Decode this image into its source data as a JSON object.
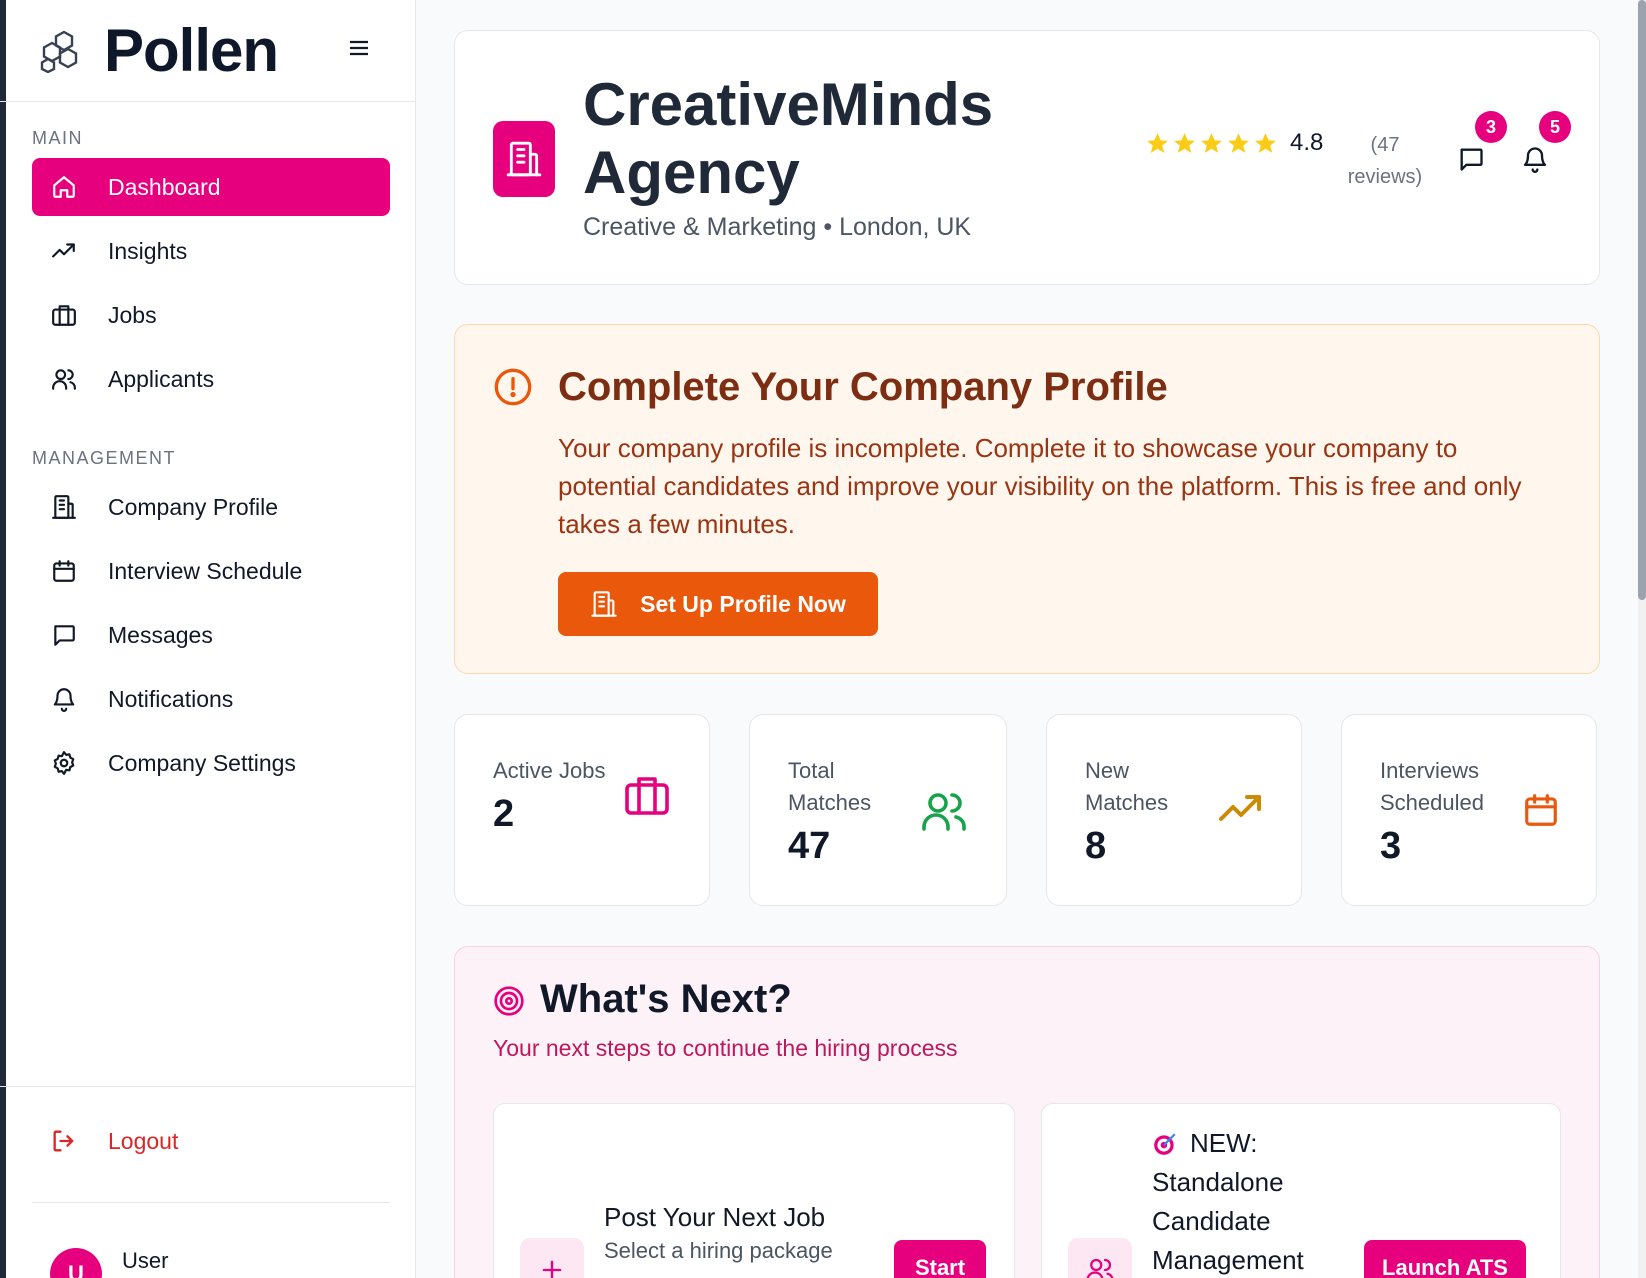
{
  "brand": {
    "name": "Pollen"
  },
  "colors": {
    "brand_pink": "#e6007e",
    "alert_orange": "#ea580c",
    "star_yellow": "#facc15"
  },
  "sidebar": {
    "main_label": "MAIN",
    "main_items": [
      {
        "label": "Dashboard",
        "icon": "home-icon",
        "active": true
      },
      {
        "label": "Insights",
        "icon": "trending-up-icon"
      },
      {
        "label": "Jobs",
        "icon": "briefcase-icon"
      },
      {
        "label": "Applicants",
        "icon": "users-icon"
      }
    ],
    "management_label": "MANAGEMENT",
    "management_items": [
      {
        "label": "Company Profile",
        "icon": "building-icon"
      },
      {
        "label": "Interview Schedule",
        "icon": "calendar-icon"
      },
      {
        "label": "Messages",
        "icon": "message-icon"
      },
      {
        "label": "Notifications",
        "icon": "bell-icon"
      },
      {
        "label": "Company Settings",
        "icon": "gear-icon"
      }
    ],
    "logout_label": "Logout",
    "user": {
      "initial": "U",
      "name": "User"
    }
  },
  "header": {
    "company_name": "CreativeMinds Agency",
    "subtitle": "Creative & Marketing • London, UK",
    "rating": "4.8",
    "reviews": "(47 reviews)",
    "messages_count": "3",
    "notifications_count": "5"
  },
  "alert": {
    "title": "Complete Your Company Profile",
    "text": "Your company profile is incomplete. Complete it to showcase your company to potential candidates and improve your visibility on the platform. This is free and only takes a few minutes.",
    "button_label": "Set Up Profile Now"
  },
  "stats": [
    {
      "label": "Active Jobs",
      "value": "2",
      "icon": "briefcase-icon",
      "color": "#e6007e"
    },
    {
      "label": "Total Matches",
      "value": "47",
      "icon": "users-icon",
      "color": "#16a34a"
    },
    {
      "label": "New Matches",
      "value": "8",
      "icon": "trending-up-icon",
      "color": "#ca8a04"
    },
    {
      "label": "Interviews Scheduled",
      "value": "3",
      "icon": "calendar-icon",
      "color": "#ea580c"
    }
  ],
  "next": {
    "title": "What's Next?",
    "subtitle": "Your next steps to continue the hiring process",
    "items": [
      {
        "title": "Post Your Next Job",
        "subtitle": "Select a hiring package",
        "button": "Start",
        "icon": "plus-icon"
      },
      {
        "badge": "NEW:",
        "title": "Standalone Candidate Management",
        "button": "Launch ATS",
        "icon": "users-icon"
      }
    ]
  }
}
